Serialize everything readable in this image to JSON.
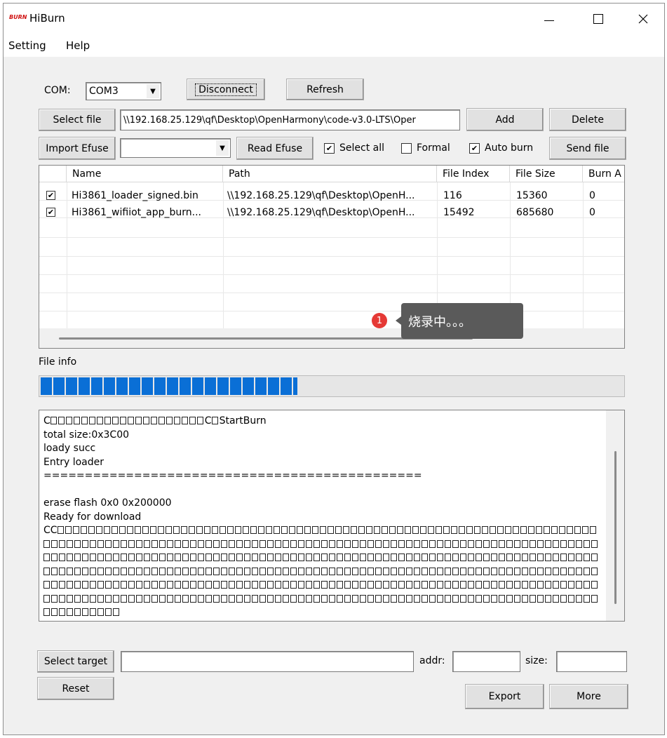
{
  "window": {
    "title": "HiBurn",
    "logo_text": "BURN"
  },
  "menu": [
    "Setting",
    "Help"
  ],
  "com": {
    "label": "COM:",
    "value": "COM3",
    "disconnect_label": "Disconnect",
    "refresh_label": "Refresh"
  },
  "file": {
    "select_label": "Select file",
    "path": "\\\\192.168.25.129\\qf\\Desktop\\OpenHarmony\\code-v3.0-LTS\\Oper",
    "add_label": "Add",
    "delete_label": "Delete"
  },
  "efuse": {
    "import_label": "Import Efuse",
    "value": "",
    "read_label": "Read Efuse",
    "select_all_label": "Select all",
    "select_all": true,
    "formal_label": "Formal",
    "formal": false,
    "auto_burn_label": "Auto burn",
    "auto_burn": true,
    "send_label": "Send file"
  },
  "table": {
    "columns": [
      "Name",
      "Path",
      "File Index",
      "File Size",
      "Burn A"
    ],
    "rows": [
      {
        "checked": true,
        "name": "Hi3861_loader_signed.bin",
        "path": "\\\\192.168.25.129\\qf\\Desktop\\OpenH...",
        "index": "116",
        "size": "15360",
        "burn": "0"
      },
      {
        "checked": true,
        "name": "Hi3861_wifiiot_app_burn...",
        "path": "\\\\192.168.25.129\\qf\\Desktop\\OpenH...",
        "index": "15492",
        "size": "685680",
        "burn": "0"
      }
    ]
  },
  "tooltip": {
    "badge": "1",
    "text": "烧录中。。。"
  },
  "file_info": {
    "label": "File info",
    "progress": 0.44
  },
  "log": {
    "lines": [
      {
        "pre": "C",
        "boxes": 20,
        "post": "C",
        "boxes2": 1,
        "post2": "StartBurn"
      },
      {
        "text": "total size:0x3C00"
      },
      {
        "text": "loady succ"
      },
      {
        "text": "Entry loader"
      },
      {
        "text": "=============================================="
      },
      {
        "text": ""
      },
      {
        "text": "erase flash 0x0 0x200000"
      },
      {
        "text": "Ready for download"
      },
      {
        "pre": "CC",
        "boxes": 70
      },
      {
        "boxes": 72
      },
      {
        "boxes": 72
      },
      {
        "boxes": 72
      },
      {
        "boxes": 72
      },
      {
        "boxes": 72
      },
      {
        "boxes": 10
      }
    ]
  },
  "bottom": {
    "select_target_label": "Select target",
    "target_value": "",
    "addr_label": "addr:",
    "addr_value": "",
    "size_label": "size:",
    "size_value": "",
    "reset_label": "Reset",
    "export_label": "Export",
    "more_label": "More"
  },
  "colors": {
    "progress": "#0a6fd6",
    "badge": "#e53935",
    "tooltip_bg": "#5a5a5a"
  }
}
